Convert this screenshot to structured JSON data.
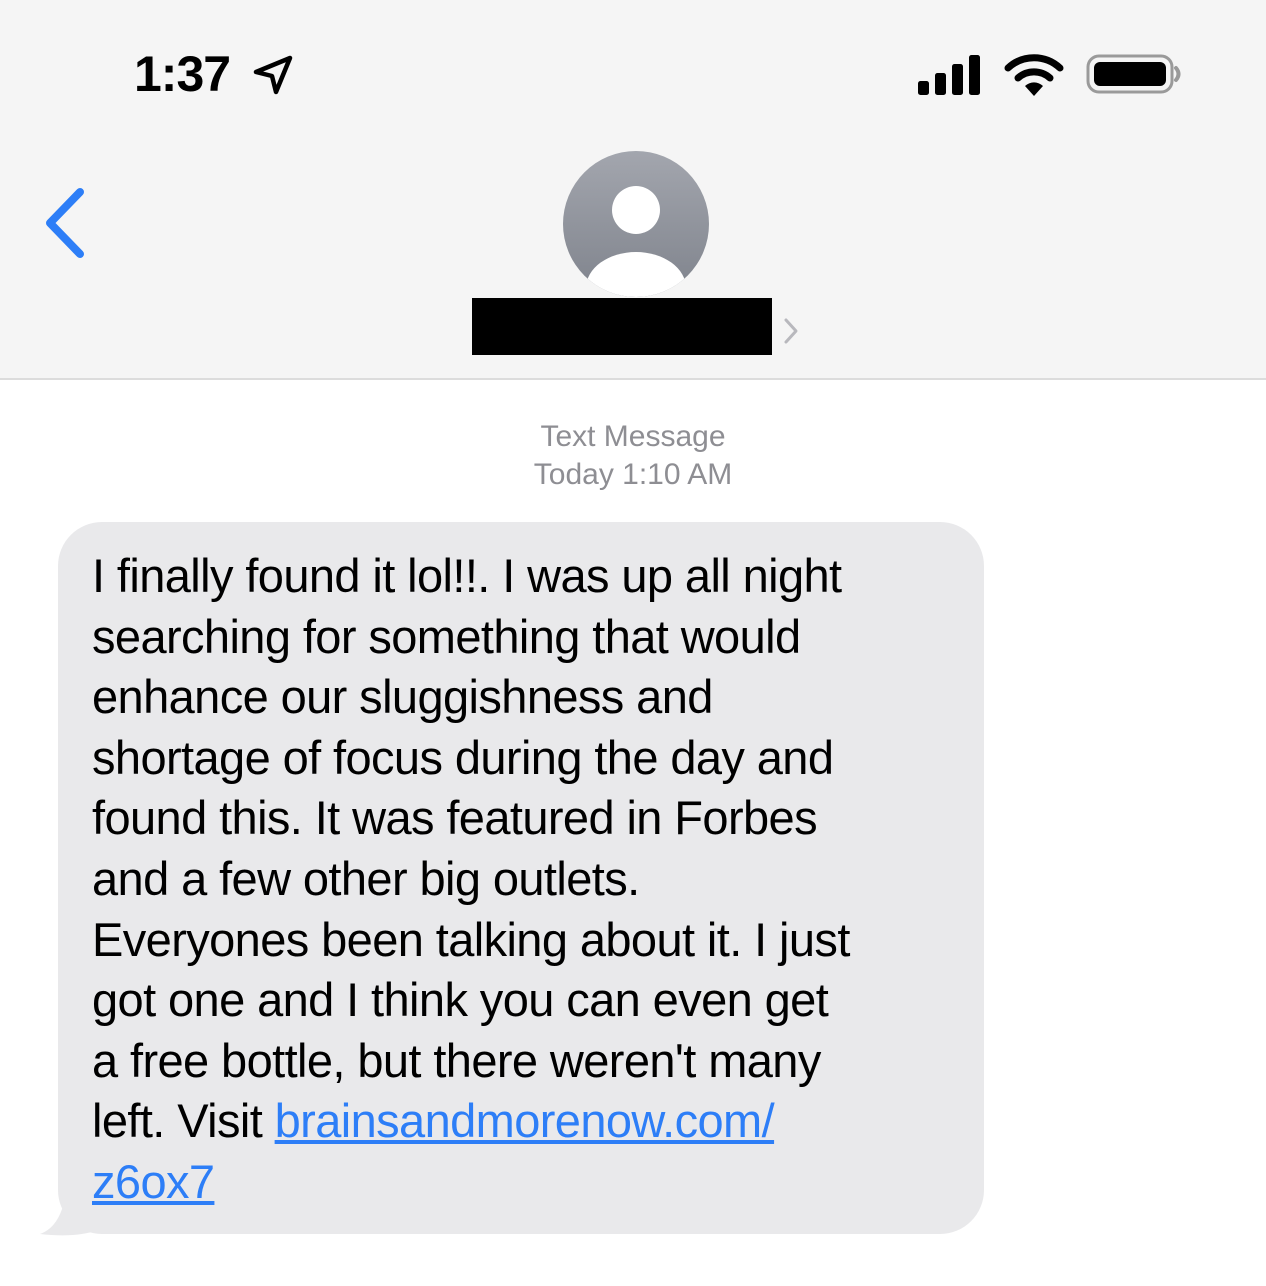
{
  "status_bar": {
    "time": "1:37",
    "icons": [
      "location-arrow-icon",
      "cellular-signal-icon",
      "wifi-icon",
      "battery-icon"
    ]
  },
  "header": {
    "back_icon": "chevron-left-icon",
    "avatar_icon": "person-icon",
    "contact_name_state": "redacted",
    "contact_chevron_icon": "chevron-right-icon"
  },
  "conversation": {
    "service_label": "Text Message",
    "timestamp": "Today 1:10 AM",
    "messages": [
      {
        "direction": "incoming",
        "lines": [
          "I finally found it lol!!. I was up all night",
          "searching for something that would",
          "enhance our sluggishness and",
          "shortage of focus during the day and",
          "found this. It was featured in Forbes",
          "and a few other big outlets.",
          "Everyones been talking about it. I just",
          "got one and I think you can even get",
          "a free bottle, but there weren't many",
          "left. Visit "
        ],
        "link_part1": "brainsandmorenow.com/",
        "link_part2": "z6ox7"
      }
    ]
  },
  "colors": {
    "accent": "#2d7ef7",
    "bubble_incoming": "#e9e9eb",
    "header_bg": "#f5f5f5",
    "meta_text": "#8e8e93"
  }
}
